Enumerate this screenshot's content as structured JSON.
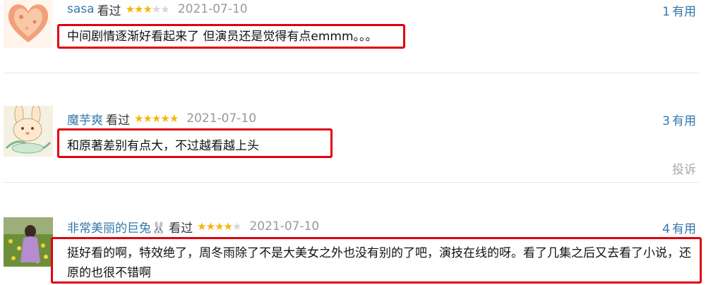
{
  "comments": [
    {
      "user": "sasa",
      "action": "看过",
      "stars": 3,
      "date": "2021-07-10",
      "useful_count": "1",
      "useful_label": "有用",
      "text": "中间剧情逐渐好看起来了 但演员还是觉得有点emmm。。。",
      "avatar": "heart-avatar",
      "highlight_color": "#e0000e"
    },
    {
      "user": "魔芋爽",
      "action": "看过",
      "stars": 5,
      "date": "2021-07-10",
      "useful_count": "3",
      "useful_label": "有用",
      "text": "和原著差别有点大，不过越看越上头",
      "avatar": "bunny-cartoon-avatar",
      "report_label": "投诉",
      "highlight_color": "#e0000e"
    },
    {
      "user": "非常美丽的巨兔🐰",
      "action": "看过",
      "stars": 4,
      "date": "2021-07-10",
      "useful_count": "4",
      "useful_label": "有用",
      "text": "挺好看的啊，特效绝了，周冬雨除了不是大美女之外也没有别的了吧，演技在线的呀。看了几集之后又去看了小说，还原的也很不错啊",
      "avatar": "flower-field-photo-avatar",
      "highlight_color": "#e0000e"
    }
  ],
  "colors": {
    "link": "#3377aa",
    "star": "#f7b500",
    "highlight": "#e0000e"
  }
}
